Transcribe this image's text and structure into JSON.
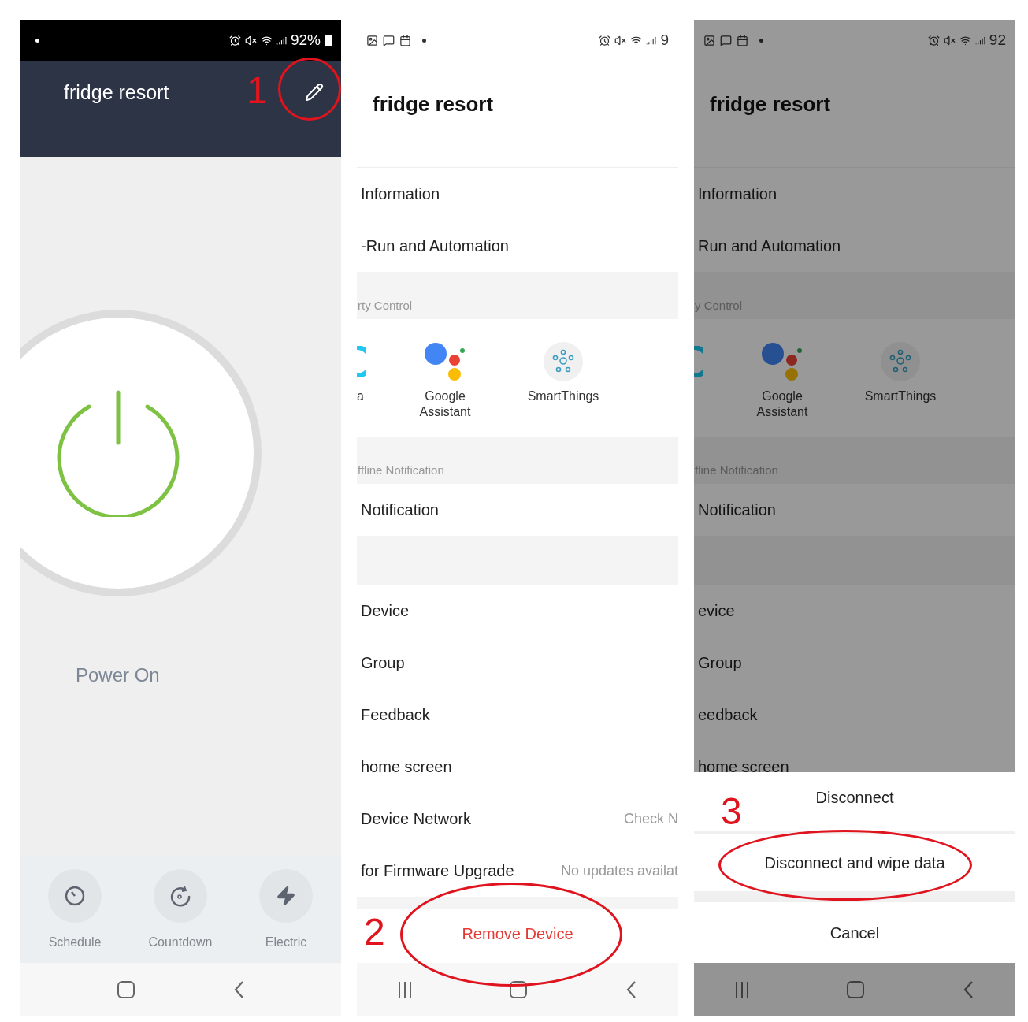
{
  "panels": [
    {
      "kind": "device",
      "status_bar": {
        "reading": "92%"
      },
      "title": "fridge resort",
      "power": {
        "on": true,
        "label": "Power On"
      },
      "actions": [
        {
          "kind": "schedule",
          "label": "Schedule"
        },
        {
          "kind": "countdown",
          "label": "Countdown"
        },
        {
          "kind": "electric",
          "label": "Electric"
        }
      ],
      "recents_button": false
    },
    {
      "kind": "settings",
      "status_bar": {
        "reading": "9"
      },
      "title": "fridge resort",
      "dimmed": false,
      "items": [
        {
          "kind": "row",
          "label": "Information"
        },
        {
          "kind": "row",
          "label": "-Run and Automation"
        },
        {
          "kind": "header",
          "label": "rty Control"
        },
        {
          "kind": "integrations",
          "items": [
            {
              "kind": "alexa",
              "label": "a"
            },
            {
              "kind": "google",
              "label": "Google Assistant"
            },
            {
              "kind": "smartthings",
              "label": "SmartThings"
            }
          ]
        },
        {
          "kind": "header",
          "label": "ffline Notification"
        },
        {
          "kind": "row",
          "label": "Notification"
        },
        {
          "kind": "spacer"
        },
        {
          "kind": "row",
          "label": "Device"
        },
        {
          "kind": "row",
          "label": "Group"
        },
        {
          "kind": "row",
          "label": "Feedback"
        },
        {
          "kind": "row",
          "label": "home screen"
        },
        {
          "kind": "row",
          "label": "Device Network",
          "value": "Check N"
        },
        {
          "kind": "row",
          "label": "for Firmware Upgrade",
          "value": "No updates availat"
        },
        {
          "kind": "gap"
        },
        {
          "kind": "danger",
          "label": "Remove Device"
        }
      ],
      "recents_button": true
    },
    {
      "kind": "settings",
      "status_bar": {
        "reading": "92"
      },
      "title": "fridge resort",
      "dimmed": true,
      "items": [
        {
          "kind": "row",
          "label": "Information"
        },
        {
          "kind": "row",
          "label": "Run and Automation"
        },
        {
          "kind": "header",
          "label": "y Control"
        },
        {
          "kind": "integrations",
          "items": [
            {
              "kind": "alexa"
            },
            {
              "kind": "google",
              "label": "Google Assistant"
            },
            {
              "kind": "smartthings",
              "label": "SmartThings"
            }
          ]
        },
        {
          "kind": "header",
          "label": "fline Notification"
        },
        {
          "kind": "row",
          "label": "Notification"
        },
        {
          "kind": "spacer"
        },
        {
          "kind": "row",
          "label": "evice"
        },
        {
          "kind": "row",
          "label": "Group"
        },
        {
          "kind": "row",
          "label": "eedback"
        },
        {
          "kind": "row",
          "label": "home screen"
        }
      ],
      "sheet": [
        {
          "label": "Disconnect"
        },
        {
          "label": "Disconnect and wipe data"
        },
        {
          "label": "Cancel"
        }
      ],
      "recents_button": true
    }
  ],
  "annotations": [
    {
      "label": "1"
    },
    {
      "label": "2"
    },
    {
      "label": "3"
    }
  ]
}
